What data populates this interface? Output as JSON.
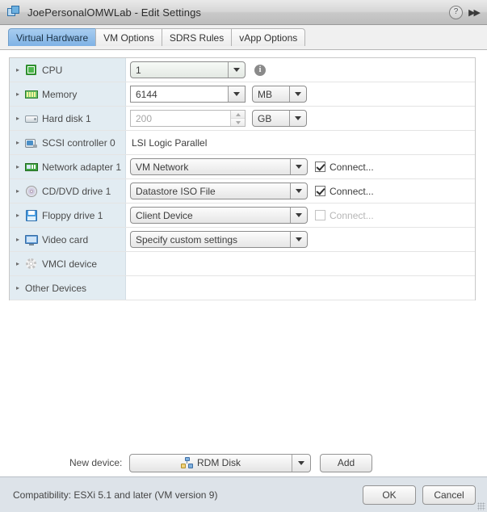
{
  "window": {
    "title": "JoePersonalOMWLab - Edit Settings",
    "icon": "vm-icon",
    "help_icon": "?",
    "expand_icon": "▶▶"
  },
  "tabs": [
    {
      "label": "Virtual Hardware",
      "active": true
    },
    {
      "label": "VM Options",
      "active": false
    },
    {
      "label": "SDRS Rules",
      "active": false
    },
    {
      "label": "vApp Options",
      "active": false
    }
  ],
  "devices": [
    {
      "label": "CPU",
      "icon": "cpu-icon",
      "control": "combo",
      "value": "1",
      "info_icon": "i"
    },
    {
      "label": "Memory",
      "icon": "memory-icon",
      "control": "combo-flat-unit",
      "value": "6144",
      "unit": "MB"
    },
    {
      "label": "Hard disk 1",
      "icon": "harddisk-icon",
      "control": "spinner-unit",
      "value": "200",
      "unit": "GB",
      "disabled": true
    },
    {
      "label": "SCSI controller 0",
      "icon": "scsi-icon",
      "control": "text",
      "value": "LSI Logic Parallel"
    },
    {
      "label": "Network adapter 1",
      "icon": "network-icon",
      "control": "combo-connect",
      "value": "VM Network",
      "connect_label": "Connect...",
      "connected": true
    },
    {
      "label": "CD/DVD drive 1",
      "icon": "cddvd-icon",
      "control": "combo-connect",
      "value": "Datastore ISO File",
      "connect_label": "Connect...",
      "connected": true
    },
    {
      "label": "Floppy drive 1",
      "icon": "floppy-icon",
      "control": "combo-connect",
      "value": "Client Device",
      "connect_label": "Connect...",
      "connected": false
    },
    {
      "label": "Video card",
      "icon": "videocard-icon",
      "control": "combo",
      "value": "Specify custom settings"
    },
    {
      "label": "VMCI device",
      "icon": "vmci-icon",
      "control": "none",
      "value": ""
    },
    {
      "label": "Other Devices",
      "icon": "none",
      "control": "none",
      "value": ""
    }
  ],
  "new_device": {
    "label": "New device:",
    "selected": "RDM Disk",
    "icon": "rdm-disk-icon",
    "add_label": "Add"
  },
  "footer": {
    "compatibility": "Compatibility: ESXi 5.1 and later (VM version 9)",
    "ok_label": "OK",
    "cancel_label": "Cancel"
  },
  "colors": {
    "accent": "#7fb2e5",
    "label_column": "#e2ecf2",
    "footer_bg": "#dde3e9",
    "titlebar_bg": "#d2d2d2"
  }
}
